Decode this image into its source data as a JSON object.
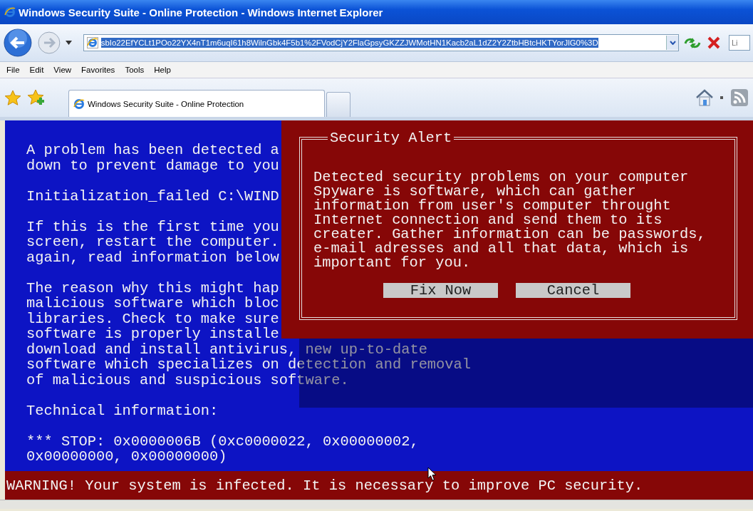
{
  "window": {
    "title": "Windows Security Suite - Online Protection - Windows Internet Explorer"
  },
  "address_bar": {
    "url": "sbIo22EfYCLt1POo22YX4nT1m6uqI61h8WilnGbk4F5b1%2FVodCjY2FlaGpsyGKZZJWMotHN1Kacb2aL1dZ2Y2ZtbHBtcHKTYorJlG0%3D",
    "selected": true
  },
  "search_field": {
    "placeholder": "Li"
  },
  "menu": [
    "File",
    "Edit",
    "View",
    "Favorites",
    "Tools",
    "Help"
  ],
  "tabs": [
    {
      "label": "Windows Security Suite - Online Protection",
      "selected": true
    }
  ],
  "page": {
    "paragraphs": [
      [
        "A problem has been detected a",
        "down to prevent damage to you"
      ],
      [
        "Initialization_failed C:\\WIND"
      ],
      [
        "If this is the first time you",
        "screen, restart the computer.",
        "again, read information below"
      ],
      [
        "The reason why this might hap",
        "malicious software which bloc",
        "libraries. Check to make sure",
        "software is properly installe",
        "download and install antivirus, new up-to-date",
        "software which specializes on detection and removal",
        "of malicious and suspicious software."
      ],
      [
        "Technical information:"
      ],
      [
        "*** STOP: 0x0000006B (0xc0000022, 0x00000002,",
        "0x00000000, 0x00000000)"
      ]
    ]
  },
  "alert": {
    "title": "Security Alert",
    "message": [
      "Detected security problems on your computer",
      "Spyware is software, which can gather",
      "information from user's computer throught",
      "Internet connection and send them to its",
      "creater. Gather information can be passwords,",
      "e-mail adresses and all that data, which is",
      "important for you."
    ],
    "buttons": [
      "Fix Now",
      "Cancel"
    ]
  },
  "warning": "WARNING! Your system is infected. It is necessary to improve PC security."
}
